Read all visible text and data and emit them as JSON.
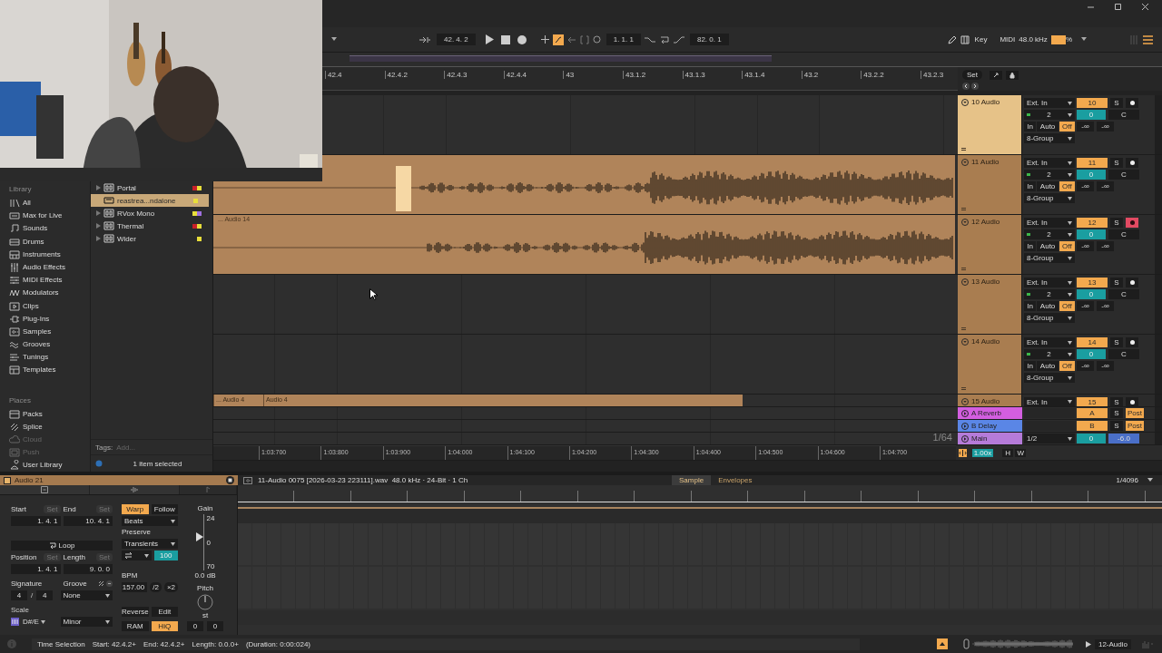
{
  "control_bar": {
    "arrangement_position": "42. 4. 2",
    "draw_mode": true,
    "loop_start": "1. 1. 1",
    "loop_length": "82. 0. 1",
    "key": "Key",
    "midi": "MIDI",
    "sample_rate": "48.0 kHz",
    "cpu": {
      "level": 1,
      "unit": "%"
    }
  },
  "beat_ruler": [
    "42.4",
    "42.4.2",
    "42.4.3",
    "42.4.4",
    "43",
    "43.1.2",
    "43.1.3",
    "43.1.4",
    "43.2",
    "43.2.2",
    "43.2.3"
  ],
  "set_button": "Set",
  "browser": {
    "library_heading": "Library",
    "categories": [
      {
        "label": "All"
      },
      {
        "label": "Max for Live"
      },
      {
        "label": "Sounds"
      },
      {
        "label": "Drums"
      },
      {
        "label": "Instruments"
      },
      {
        "label": "Audio Effects"
      },
      {
        "label": "MIDI Effects"
      },
      {
        "label": "Modulators"
      },
      {
        "label": "Clips"
      },
      {
        "label": "Plug-Ins"
      },
      {
        "label": "Samples"
      },
      {
        "label": "Grooves"
      },
      {
        "label": "Tunings"
      },
      {
        "label": "Templates"
      }
    ],
    "places_heading": "Places",
    "places": [
      {
        "label": "Packs",
        "disabled": false
      },
      {
        "label": "Splice",
        "disabled": false
      },
      {
        "label": "Cloud",
        "disabled": true
      },
      {
        "label": "Push",
        "disabled": true
      },
      {
        "label": "User Library",
        "disabled": false
      }
    ],
    "items": [
      {
        "name": "Portal",
        "expandable": true,
        "selected": false,
        "tags": [
          {
            "color": "#c8202a"
          },
          {
            "color": "#e8de3a"
          }
        ]
      },
      {
        "name": "reastrea...ndalone",
        "expandable": false,
        "selected": true,
        "tags": [
          {
            "color": "#e8de3a"
          }
        ]
      },
      {
        "name": "RVox Mono",
        "expandable": true,
        "selected": false,
        "tags": [
          {
            "color": "#e8de3a"
          },
          {
            "color": "#a070e0"
          }
        ]
      },
      {
        "name": "Thermal",
        "expandable": true,
        "selected": false,
        "tags": [
          {
            "color": "#c8202a"
          },
          {
            "color": "#e8de3a"
          }
        ]
      },
      {
        "name": "Wider",
        "expandable": true,
        "selected": false,
        "tags": [
          {
            "color": "#e8de3a"
          }
        ]
      }
    ],
    "tags_label": "Tags:",
    "tags_placeholder": "Add...",
    "status": "1 item selected"
  },
  "tracks": [
    {
      "name": "10 Audio",
      "selected": true,
      "input": "Ext. In",
      "channel": "2",
      "monitor": [
        {
          "label": "In",
          "selected": false
        },
        {
          "label": "Auto",
          "selected": false
        },
        {
          "label": "Off",
          "selected": true
        }
      ],
      "output": "8-Group",
      "number": "10",
      "solo": "S",
      "armed": false,
      "volume": "0",
      "pan": "C",
      "peak_left": "-∞",
      "peak_right": "-∞"
    },
    {
      "name": "11 Audio",
      "selected": false,
      "input": "Ext. In",
      "channel": "2",
      "monitor": [
        {
          "label": "In",
          "selected": false
        },
        {
          "label": "Auto",
          "selected": false
        },
        {
          "label": "Off",
          "selected": true
        }
      ],
      "output": "8-Group",
      "number": "11",
      "solo": "S",
      "armed": false,
      "volume": "0",
      "pan": "C",
      "peak_left": "-∞",
      "peak_right": "-∞",
      "clips": [
        {
          "kind": "waveform",
          "selection": true
        }
      ]
    },
    {
      "name": "12 Audio",
      "selected": false,
      "input": "Ext. In",
      "channel": "2",
      "monitor": [
        {
          "label": "In",
          "selected": false
        },
        {
          "label": "Auto",
          "selected": false
        },
        {
          "label": "Off",
          "selected": true
        }
      ],
      "output": "8-Group",
      "number": "12",
      "solo": "S",
      "armed": true,
      "volume": "0",
      "pan": "C",
      "peak_left": "-∞",
      "peak_right": "-∞",
      "clips": [
        {
          "kind": "waveform",
          "name": "... Audio 14",
          "selection": false
        }
      ]
    },
    {
      "name": "13 Audio",
      "selected": false,
      "input": "Ext. In",
      "channel": "2",
      "monitor": [
        {
          "label": "In",
          "selected": false
        },
        {
          "label": "Auto",
          "selected": false
        },
        {
          "label": "Off",
          "selected": true
        }
      ],
      "output": "8-Group",
      "number": "13",
      "solo": "S",
      "armed": false,
      "volume": "0",
      "pan": "C",
      "peak_left": "-∞",
      "peak_right": "-∞"
    },
    {
      "name": "14 Audio",
      "selected": false,
      "input": "Ext. In",
      "channel": "2",
      "monitor": [
        {
          "label": "In",
          "selected": false
        },
        {
          "label": "Auto",
          "selected": false
        },
        {
          "label": "Off",
          "selected": true
        }
      ],
      "output": "8-Group",
      "number": "14",
      "solo": "S",
      "armed": false,
      "volume": "0",
      "pan": "C",
      "peak_left": "-∞",
      "peak_right": "-∞"
    },
    {
      "name": "15 Audio",
      "selected": false,
      "input": "Ext. In",
      "number": "15",
      "solo": "S",
      "armed": false,
      "clips": [
        {
          "kind": "plain",
          "name": "... Audio 4"
        },
        {
          "kind": "plain",
          "name": "Audio 4"
        }
      ]
    }
  ],
  "returns": [
    {
      "name": "A Reverb",
      "color": "#d35ee0",
      "send": "A",
      "solo": "S",
      "post": "Post"
    },
    {
      "name": "B Delay",
      "color": "#5a86e6",
      "send": "B",
      "solo": "S",
      "post": "Post"
    }
  ],
  "main": {
    "name": "Main",
    "color": "#b57bd9",
    "output": "1/2",
    "volume": "0",
    "reading": "-6.0"
  },
  "zoom_label": "1/64",
  "time_ruler": [
    "1:03:700",
    "1:03:800",
    "1:03:900",
    "1:04:000",
    "1:04:100",
    "1:04:200",
    "1:04:300",
    "1:04:400",
    "1:04:500",
    "1:04:600",
    "1:04:700"
  ],
  "tempo_zoom": "1.00x",
  "h_button": "H",
  "w_button": "W",
  "clip": {
    "name": "Audio 21",
    "file_info": "11-Audio 0075 [2026-03-23 223111].wav  48.0 kHz · 24-Bit · 1 Ch",
    "tabs": [
      {
        "label": "Sample",
        "selected": true
      },
      {
        "label": "Envelopes",
        "selected": false
      }
    ],
    "grid": "1/4096",
    "start": {
      "label": "Start",
      "set": "Set",
      "value": "1. 4. 1"
    },
    "end": {
      "label": "End",
      "set": "Set",
      "value": "10. 4. 1"
    },
    "loop": {
      "label": "Loop",
      "on": false
    },
    "position": {
      "label": "Position",
      "set": "Set",
      "value": "1. 4. 1"
    },
    "length": {
      "label": "Length",
      "set": "Set",
      "value": "9. 0. 0"
    },
    "signature": {
      "label": "Signature",
      "numerator": "4",
      "separator": "/",
      "denominator": "4"
    },
    "groove": {
      "label": "Groove",
      "value": "None"
    },
    "scale": {
      "label": "Scale",
      "root": "D#/E",
      "mode": "Minor"
    },
    "warp": {
      "label": "Warp",
      "on": true
    },
    "follow": {
      "label": "Follow",
      "on": false
    },
    "warp_mode": "Beats",
    "preserve_label": "Preserve",
    "preserve": "Transients",
    "envelope": "100",
    "bpm_label": "BPM",
    "bpm": "157.00",
    "half": "/2",
    "double": "×2",
    "reverse": {
      "label": "Reverse",
      "on": false
    },
    "edit": "Edit",
    "ram": {
      "label": "RAM",
      "on": false
    },
    "hiq": {
      "label": "HiQ",
      "on": true
    },
    "gain": {
      "label": "Gain",
      "scale": [
        "24",
        "0",
        "70"
      ],
      "reading": "0.0 dB",
      "level": 0.6
    },
    "pitch": {
      "label": "Pitch",
      "unit": "st",
      "semitones": "0",
      "cents": "0"
    }
  },
  "status": {
    "title": "Time Selection",
    "start": "Start: 42.4.2+",
    "end": "End: 42.4.2+",
    "length": "Length: 0.0.0+",
    "duration": "(Duration: 0:00:024)",
    "track": "12-Audio"
  }
}
